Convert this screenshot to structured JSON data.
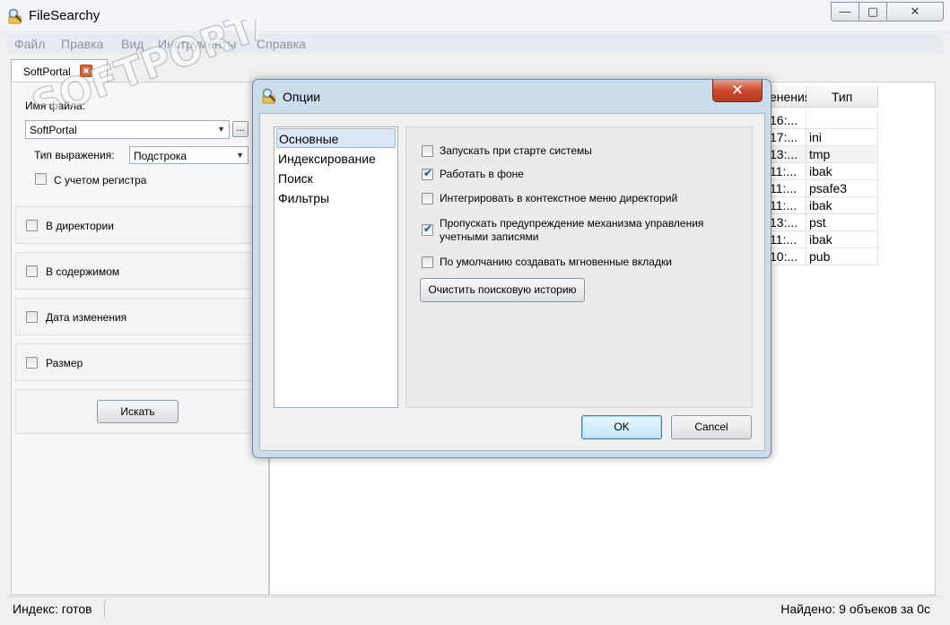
{
  "app": {
    "title": "FileSearchy",
    "menu": [
      "Файл",
      "Правка",
      "Вид",
      "Инструменты",
      "Справка"
    ],
    "tab": {
      "label": "SoftPortal"
    }
  },
  "search_panel": {
    "filename_label": "Имя файла:",
    "filename_value": "SoftPortal",
    "browse_label": "...",
    "expr_type_label": "Тип выражения:",
    "expr_type_value": "Подстрока",
    "case_label": "С учетом регистра",
    "groups": [
      {
        "label": "В директории"
      },
      {
        "label": "В содержимом"
      },
      {
        "label": "Дата изменения"
      },
      {
        "label": "Размер"
      }
    ],
    "search_button": "Искать"
  },
  "results": {
    "columns": [
      "енения",
      "Тип"
    ],
    "rows": [
      {
        "date": "16:...",
        "type": ""
      },
      {
        "date": "17:...",
        "type": "ini"
      },
      {
        "date": "13:...",
        "type": "tmp"
      },
      {
        "date": "11:...",
        "type": "ibak"
      },
      {
        "date": "11:...",
        "type": "psafe3"
      },
      {
        "date": "11:...",
        "type": "ibak"
      },
      {
        "date": "13:...",
        "type": "pst"
      },
      {
        "date": "11:...",
        "type": "ibak"
      },
      {
        "date": "10:...",
        "type": "pub"
      }
    ]
  },
  "status": {
    "index": "Индекс: готов",
    "found": "Найдено: 9 объеков за 0с"
  },
  "watermark": "SOFTPORTAL",
  "dialog": {
    "title": "Опции",
    "nav": [
      {
        "label": "Основные",
        "selected": true
      },
      {
        "label": "Индексирование",
        "selected": false
      },
      {
        "label": "Поиск",
        "selected": false
      },
      {
        "label": "Фильтры",
        "selected": false
      }
    ],
    "options": [
      {
        "label": "Запускать при старте системы",
        "checked": false
      },
      {
        "label": "Работать в фоне",
        "checked": true
      },
      {
        "label": "Интегрировать в контекстное меню директорий",
        "checked": false
      },
      {
        "label": "Пропускать предупреждение механизма управления учетными записями",
        "checked": true
      },
      {
        "label": "По умолчанию создавать мгновенные вкладки",
        "checked": false
      }
    ],
    "clear_history": "Очистить поисковую историю",
    "ok": "OK",
    "cancel": "Cancel"
  }
}
